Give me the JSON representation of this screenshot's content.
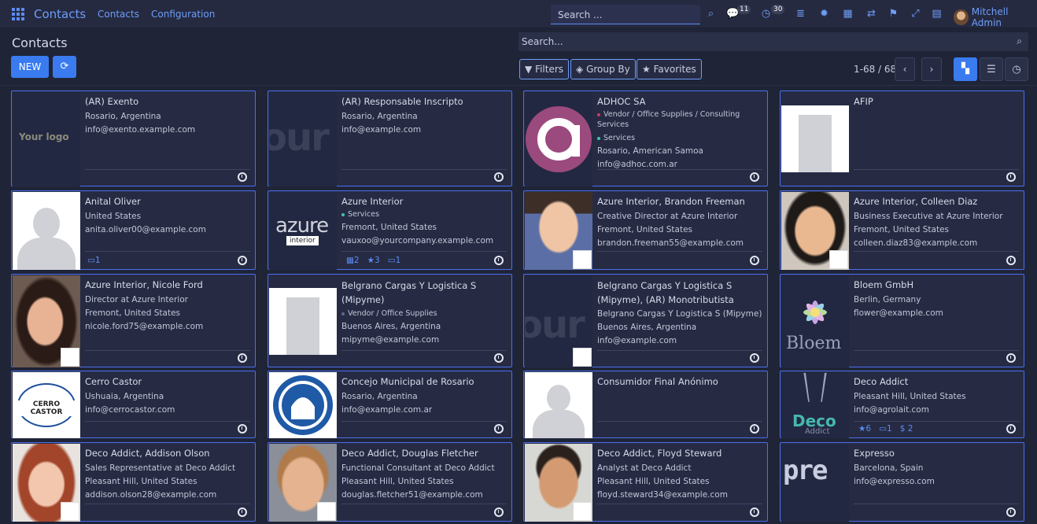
{
  "topbar": {
    "app_name": "Contacts",
    "menu": [
      "Contacts",
      "Configuration"
    ],
    "search_placeholder": "Search ...",
    "messages_count": "11",
    "activities_count": "30",
    "user_name": "Mitchell Admin"
  },
  "control": {
    "title": "Contacts",
    "new_label": "NEW",
    "search_placeholder": "Search...",
    "filters_label": "Filters",
    "groupby_label": "Group By",
    "favorites_label": "Favorites",
    "pager": "1-68 / 68"
  },
  "cards": [
    {
      "name": "(AR) Exento",
      "lines": [
        "Rosario, Argentina",
        "info@exento.example.com"
      ],
      "tags": [],
      "stats": []
    },
    {
      "name": "(AR) Responsable Inscripto",
      "lines": [
        "Rosario, Argentina",
        "info@example.com"
      ],
      "tags": [],
      "stats": []
    },
    {
      "name": "ADHOC SA",
      "lines": [
        "Rosario, American Samoa",
        "info@adhoc.com.ar"
      ],
      "tags": [
        "Vendor / Office Supplies / Consulting Services",
        "Services"
      ],
      "stats": []
    },
    {
      "name": "AFIP",
      "lines": [],
      "tags": [],
      "stats": []
    },
    {
      "name": "Anital Oliver",
      "lines": [
        "United States",
        "anita.oliver00@example.com"
      ],
      "tags": [],
      "stats": [
        "1"
      ]
    },
    {
      "name": "Azure Interior",
      "lines": [
        "Fremont, United States",
        "vauxoo@yourcompany.example.com"
      ],
      "tags": [
        "Services"
      ],
      "stats": [
        "2",
        "3",
        "1"
      ]
    },
    {
      "name": "Azure Interior, Brandon Freeman",
      "lines": [
        "Creative Director at Azure Interior",
        "Fremont, United States",
        "brandon.freeman55@example.com"
      ],
      "tags": [],
      "stats": []
    },
    {
      "name": "Azure Interior, Colleen Diaz",
      "lines": [
        "Business Executive at Azure Interior",
        "Fremont, United States",
        "colleen.diaz83@example.com"
      ],
      "tags": [],
      "stats": []
    },
    {
      "name": "Azure Interior, Nicole Ford",
      "lines": [
        "Director at Azure Interior",
        "Fremont, United States",
        "nicole.ford75@example.com"
      ],
      "tags": [],
      "stats": []
    },
    {
      "name": "Belgrano Cargas Y Logistica S (Mipyme)",
      "lines": [
        "Buenos Aires, Argentina",
        "mipyme@example.com"
      ],
      "tags": [
        "Vendor / Office Supplies"
      ],
      "stats": []
    },
    {
      "name": "Belgrano Cargas Y Logistica S (Mipyme), (AR) Monotributista",
      "lines": [
        "Belgrano Cargas Y Logistica S (Mipyme)",
        "Buenos Aires, Argentina",
        "info@example.com"
      ],
      "tags": [],
      "stats": []
    },
    {
      "name": "Bloem GmbH",
      "lines": [
        "Berlin, Germany",
        "flower@example.com"
      ],
      "tags": [],
      "stats": []
    },
    {
      "name": "Cerro Castor",
      "lines": [
        "Ushuaia, Argentina",
        "info@cerrocastor.com"
      ],
      "tags": [],
      "stats": []
    },
    {
      "name": "Concejo Municipal de Rosario",
      "lines": [
        "Rosario, Argentina",
        "info@example.com.ar"
      ],
      "tags": [],
      "stats": []
    },
    {
      "name": "Consumidor Final Anónimo",
      "lines": [],
      "tags": [],
      "stats": []
    },
    {
      "name": "Deco Addict",
      "lines": [
        "Pleasant Hill, United States",
        "info@agrolait.com"
      ],
      "tags": [],
      "stats": [
        "6",
        "1",
        "2"
      ]
    },
    {
      "name": "Deco Addict, Addison Olson",
      "lines": [
        "Sales Representative at Deco Addict",
        "Pleasant Hill, United States",
        "addison.olson28@example.com"
      ],
      "tags": [],
      "stats": []
    },
    {
      "name": "Deco Addict, Douglas Fletcher",
      "lines": [
        "Functional Consultant at Deco Addict",
        "Pleasant Hill, United States",
        "douglas.fletcher51@example.com"
      ],
      "tags": [],
      "stats": []
    },
    {
      "name": "Deco Addict, Floyd Steward",
      "lines": [
        "Analyst at Deco Addict",
        "Pleasant Hill, United States",
        "floyd.steward34@example.com"
      ],
      "tags": [],
      "stats": []
    },
    {
      "name": "Expresso",
      "lines": [
        "Barcelona, Spain",
        "info@expresso.com"
      ],
      "tags": [],
      "stats": []
    }
  ],
  "logos": {
    "your_logo": "Your logo",
    "ur_text": "our",
    "azure_word": "azure",
    "azure_sub": "interior",
    "bloem": "Bloem",
    "cerro": "CERRO CASTOR",
    "deco": "Deco",
    "deco_sub": "Addict",
    "expresso": "pre"
  }
}
